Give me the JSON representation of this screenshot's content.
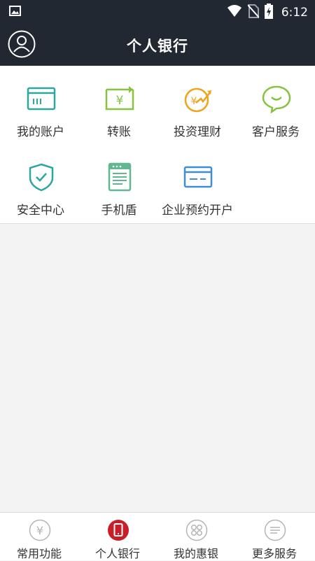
{
  "status_bar": {
    "time": "6:12"
  },
  "header": {
    "title": "个人银行"
  },
  "grid": {
    "items": [
      {
        "label": "我的账户",
        "icon": "account-card-icon"
      },
      {
        "label": "转账",
        "icon": "transfer-icon"
      },
      {
        "label": "投资理财",
        "icon": "investment-icon"
      },
      {
        "label": "客户服务",
        "icon": "customer-service-icon"
      },
      {
        "label": "安全中心",
        "icon": "shield-icon"
      },
      {
        "label": "手机盾",
        "icon": "phone-shield-icon"
      },
      {
        "label": "企业预约开户",
        "icon": "bank-card-icon"
      }
    ]
  },
  "bottom_nav": {
    "items": [
      {
        "label": "常用功能",
        "icon": "yuan-circle-icon",
        "active": false
      },
      {
        "label": "个人银行",
        "icon": "mobile-circle-icon",
        "active": true
      },
      {
        "label": "我的惠银",
        "icon": "grid-circle-icon",
        "active": false
      },
      {
        "label": "更多服务",
        "icon": "menu-circle-icon",
        "active": false
      }
    ]
  },
  "colors": {
    "header_bg": "#212832",
    "teal": "#2aa7a0",
    "green": "#86c440",
    "orange": "#f0a31c",
    "blue": "#3d8ed4",
    "active_red": "#c81e28"
  }
}
